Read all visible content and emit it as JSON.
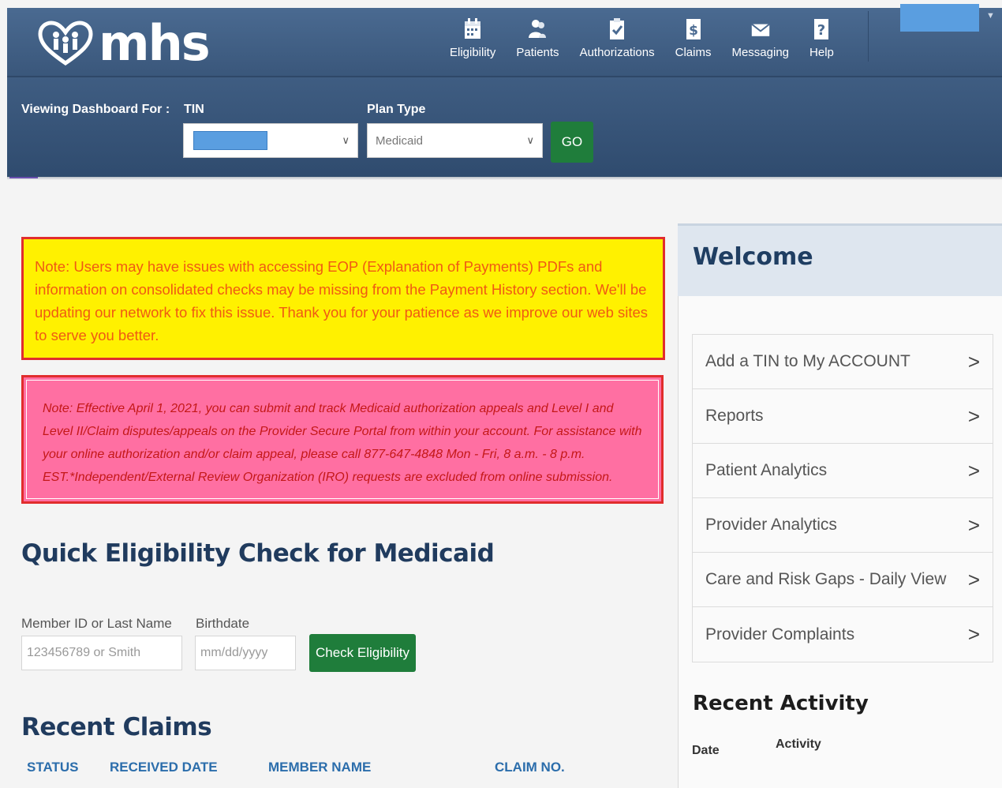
{
  "header": {
    "logo_text": "mhs",
    "nav": [
      {
        "label": "Eligibility",
        "icon": "calendar-icon"
      },
      {
        "label": "Patients",
        "icon": "patients-icon"
      },
      {
        "label": "Authorizations",
        "icon": "clipboard-check-icon"
      },
      {
        "label": "Claims",
        "icon": "dollar-document-icon"
      },
      {
        "label": "Messaging",
        "icon": "envelope-icon"
      },
      {
        "label": "Help",
        "icon": "question-icon"
      }
    ]
  },
  "filters": {
    "viewing_label": "Viewing Dashboard For :",
    "tin_label": "TIN",
    "plan_type_label": "Plan Type",
    "plan_type_value": "Medicaid",
    "go_label": "GO"
  },
  "notices": {
    "yellow": "Note: Users may have issues with accessing EOP (Explanation of Payments) PDFs and information on consolidated checks may be missing from the Payment History section. We'll be updating our network to fix this issue.  Thank you for your patience as we improve our web sites to serve you better.",
    "pink": "Note: Effective April 1, 2021, you can submit and track Medicaid authorization appeals and Level I and Level II/Claim disputes/appeals on the Provider Secure Portal from within your account. For assistance with your online authorization and/or claim appeal, please call 877-647-4848 Mon - Fri, 8 a.m. - 8 p.m. EST.*Independent/External Review Organization (IRO) requests are excluded from online submission."
  },
  "quick_check": {
    "title": "Quick Eligibility Check for Medicaid",
    "member_label": "Member ID or Last Name",
    "member_placeholder": "123456789 or Smith",
    "birthdate_label": "Birthdate",
    "birthdate_placeholder": "mm/dd/yyyy",
    "button": "Check Eligibility"
  },
  "recent_claims": {
    "title": "Recent Claims",
    "columns": [
      "STATUS",
      "RECEIVED DATE",
      "MEMBER NAME",
      "CLAIM NO."
    ]
  },
  "welcome": {
    "title": "Welcome",
    "items": [
      "Add a TIN to My ACCOUNT",
      "Reports",
      "Patient Analytics",
      "Provider Analytics",
      "Care and Risk Gaps - Daily View",
      "Provider Complaints"
    ]
  },
  "recent_activity": {
    "title": "Recent Activity",
    "col_date": "Date",
    "col_activity": "Activity"
  },
  "colors": {
    "header_bg": "#3f5d82",
    "green_button": "#1f7d3b",
    "yellow_notice": "#fff100",
    "pink_notice": "#ff6fa2",
    "notice_border": "#e12d2d",
    "redacted_fill": "#5a9ee0"
  }
}
